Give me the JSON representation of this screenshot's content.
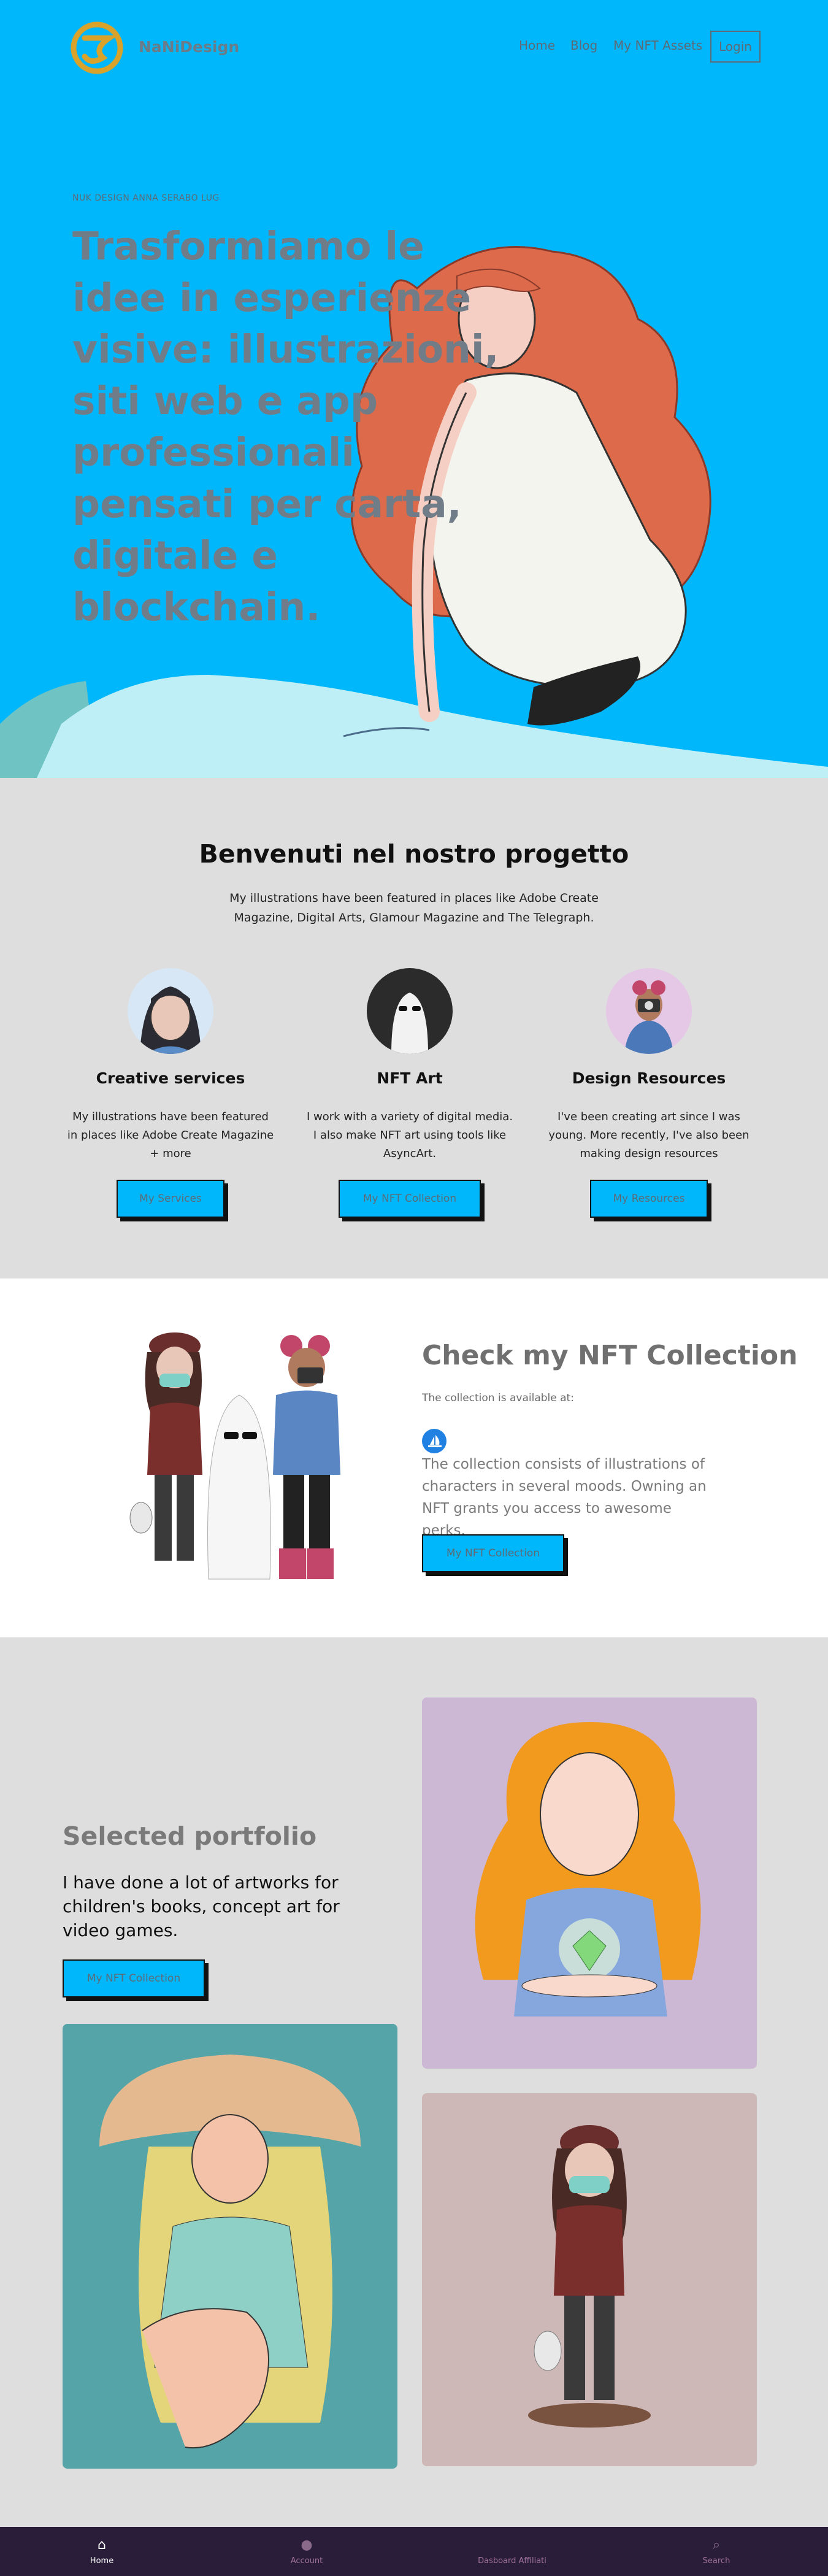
{
  "nav": {
    "brand": "NaNiDesign",
    "menu": [
      "Home",
      "Blog",
      "My NFT Assets"
    ],
    "login": "Login"
  },
  "hero": {
    "eyebrow": "NUK DESIGN ANNA SERABO LUG",
    "title": "Trasformiamo le idee in esperienze visive: illustrazioni, siti web e app professionali pensati per carta, digitale e blockchain."
  },
  "welcome": {
    "title": "Benvenuti nel nostro progetto",
    "intro": "My illustrations have been featured in places like Adobe Create Magazine, Digital Arts, Glamour Magazine and The Telegraph.",
    "cards": [
      {
        "title": "Creative services",
        "text": "My illustrations have been featured in places like Adobe Create Magazine + more",
        "button": "My Services"
      },
      {
        "title": "NFT Art",
        "text": "I work with a variety of digital media. I also make NFT art using tools like AsyncArt.",
        "button": "My NFT Collection"
      },
      {
        "title": "Design Resources",
        "text": "I've been creating art since I was young. More recently, I've also been making design resources",
        "button": "My Resources"
      }
    ]
  },
  "nft": {
    "title": "Check my NFT Collection",
    "available": "The collection is available at:",
    "description": "The collection consists of illustrations of characters in several moods. Owning an NFT grants you access to awesome perks.",
    "button": "My NFT Collection"
  },
  "portfolio": {
    "title": "Selected portfolio",
    "lead": "I have done a lot of artworks for children's books, concept art for video games.",
    "button": "My NFT Collection"
  },
  "bottom_bar": [
    {
      "icon": "home-icon",
      "label": "Home",
      "active": true
    },
    {
      "icon": "user-icon",
      "label": "Account",
      "active": false
    },
    {
      "icon": "dashboard-icon",
      "label": "Dasboard Affiliati",
      "active": false
    },
    {
      "icon": "search-icon",
      "label": "Search",
      "active": false
    }
  ],
  "colors": {
    "accent": "#00b7fb",
    "bottom_bar": "#2a1d3a",
    "section_bg": "#dedede"
  }
}
